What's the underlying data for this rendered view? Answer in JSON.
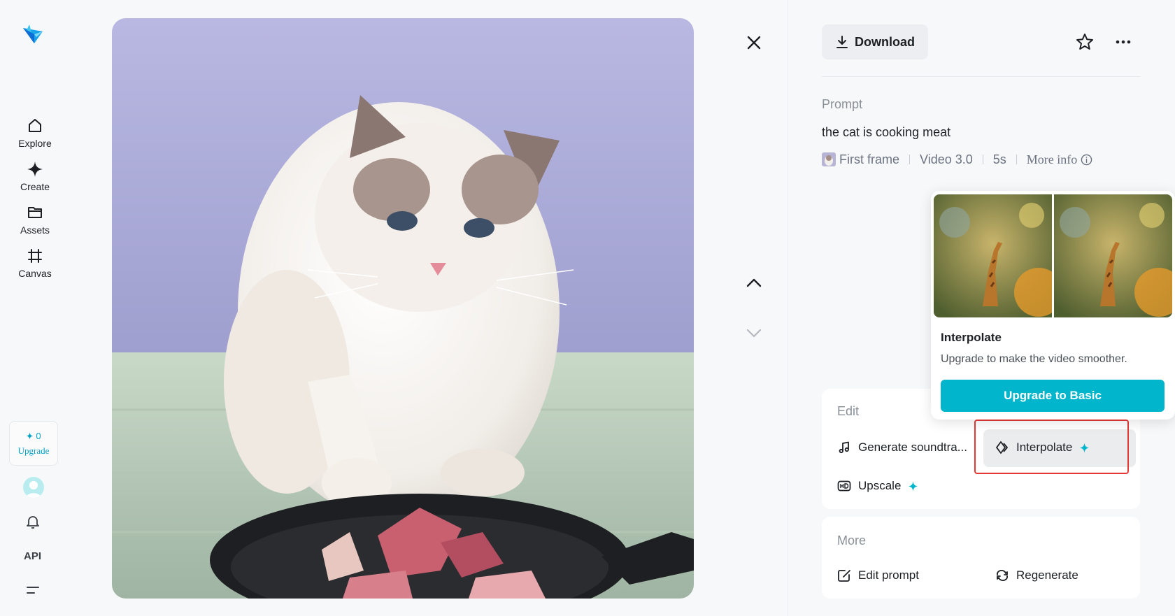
{
  "sidebar": {
    "nav": [
      {
        "label": "Explore",
        "icon": "home-icon"
      },
      {
        "label": "Create",
        "icon": "sparkle-icon"
      },
      {
        "label": "Assets",
        "icon": "folder-icon"
      },
      {
        "label": "Canvas",
        "icon": "canvas-icon"
      }
    ],
    "credits": "0",
    "upgrade_label": "Upgrade",
    "api_label": "API"
  },
  "toolbar": {
    "download_label": "Download"
  },
  "details": {
    "prompt_label": "Prompt",
    "prompt_text": "the cat is cooking meat",
    "first_frame_label": "First frame",
    "model": "Video 3.0",
    "duration": "5s",
    "more_info_label": "More info"
  },
  "popover": {
    "title": "Interpolate",
    "description": "Upgrade to make the video smoother.",
    "button_label": "Upgrade to Basic"
  },
  "edit": {
    "title": "Edit",
    "actions": [
      {
        "label": "Generate soundtra...",
        "icon": "music-note-icon"
      },
      {
        "label": "Interpolate",
        "icon": "interpolate-icon"
      },
      {
        "label": "Upscale",
        "icon": "hd-icon"
      }
    ]
  },
  "more": {
    "title": "More",
    "actions": [
      {
        "label": "Edit prompt",
        "icon": "edit-prompt-icon"
      },
      {
        "label": "Regenerate",
        "icon": "regenerate-icon"
      }
    ]
  },
  "colors": {
    "accent": "#00b5cc",
    "highlight": "#e53935",
    "background": "#f7f8fa"
  }
}
